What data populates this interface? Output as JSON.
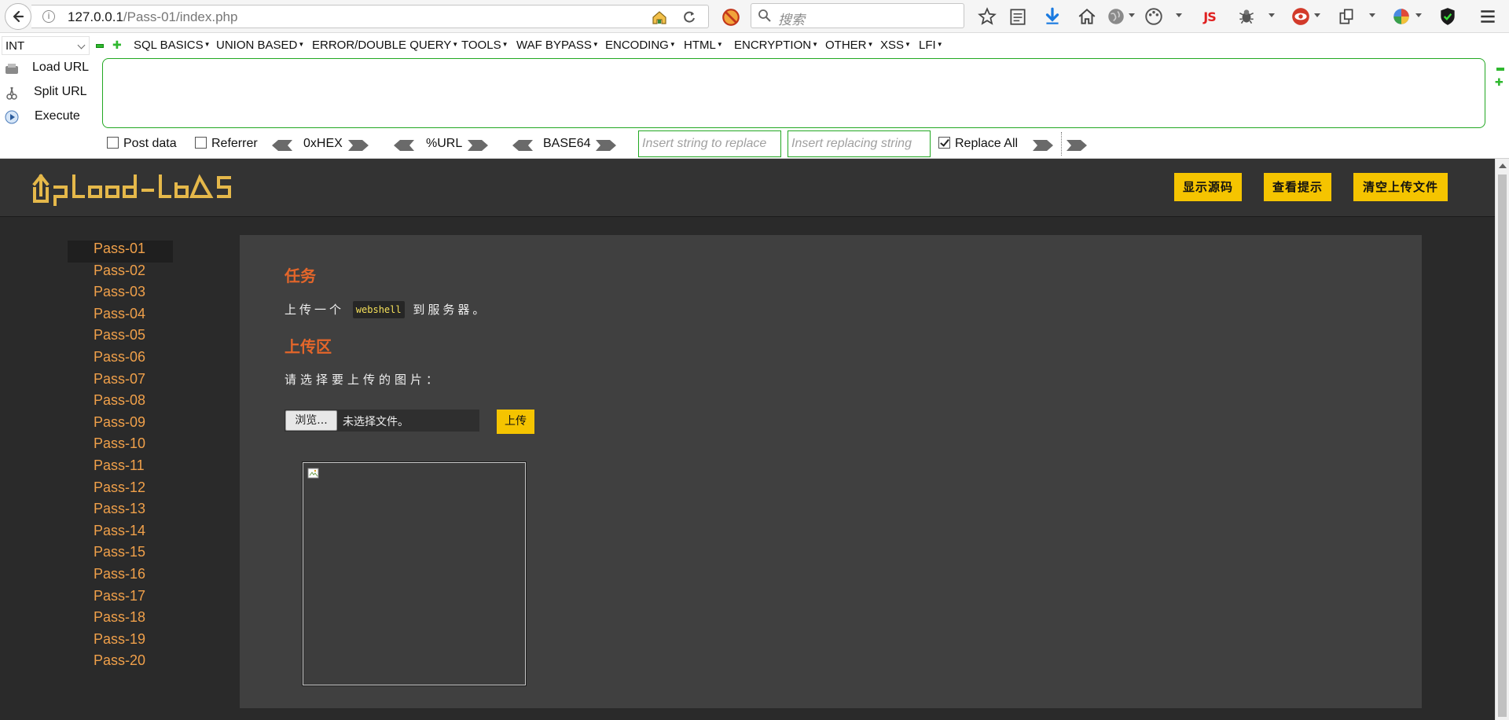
{
  "browser": {
    "url_host": "127.0.0.1",
    "url_path": "/Pass-01/index.php",
    "search_placeholder": "搜索",
    "icons": [
      "back-arrow-icon",
      "info-icon",
      "home-icon",
      "reload-icon",
      "block-icon",
      "search-icon",
      "bookmark-star-icon",
      "reading-list-icon",
      "download-icon",
      "home-icon",
      "globe-icon",
      "palette-icon",
      "js-icon",
      "bug-icon",
      "red-eye-icon",
      "copy-icon",
      "google-icon",
      "shield-icon",
      "menu-icon"
    ],
    "js_label": "JS"
  },
  "hackbar": {
    "type_select": "INT",
    "menus": [
      {
        "label": "SQL BASICS"
      },
      {
        "label": "UNION BASED"
      },
      {
        "label": "ERROR/DOUBLE QUERY"
      },
      {
        "label": "TOOLS"
      },
      {
        "label": "WAF BYPASS"
      },
      {
        "label": "ENCODING"
      },
      {
        "label": "HTML"
      },
      {
        "label": "ENCRYPTION"
      },
      {
        "label": "OTHER"
      },
      {
        "label": "XSS"
      },
      {
        "label": "LFI"
      }
    ],
    "actions": {
      "load_url": "Load URL",
      "split_url": "Split URL",
      "execute": "Execute"
    },
    "textarea_value": "",
    "options": {
      "post_data": "Post data",
      "referrer": "Referrer",
      "hex": "0xHEX",
      "url": "%URL",
      "base64": "BASE64",
      "replace_all": "Replace All"
    },
    "replace_placeholder": "Insert string to replace",
    "replacing_placeholder": "Insert replacing string",
    "checked": {
      "post_data": false,
      "referrer": false,
      "replace_all": true
    }
  },
  "page": {
    "logo_text": "Upload-labs",
    "header_buttons": {
      "show_source": "显示源码",
      "show_hint": "查看提示",
      "clear_uploads": "清空上传文件"
    },
    "sidebar": [
      "Pass-01",
      "Pass-02",
      "Pass-03",
      "Pass-04",
      "Pass-05",
      "Pass-06",
      "Pass-07",
      "Pass-08",
      "Pass-09",
      "Pass-10",
      "Pass-11",
      "Pass-12",
      "Pass-13",
      "Pass-14",
      "Pass-15",
      "Pass-16",
      "Pass-17",
      "Pass-18",
      "Pass-19",
      "Pass-20"
    ],
    "active_pass": "Pass-01",
    "main": {
      "task_title": "任务",
      "task_prefix": "上传一个",
      "task_code": "webshell",
      "task_suffix": "到服务器。",
      "upload_title": "上传区",
      "choose_label": "请选择要上传的图片：",
      "browse_label": "浏览...",
      "file_status": "未选择文件。",
      "upload_label": "上传"
    },
    "colors": {
      "accent": "#f5c400",
      "link": "#f0a04a",
      "heading": "#e4662a",
      "bg": "#2a2a2a"
    }
  }
}
